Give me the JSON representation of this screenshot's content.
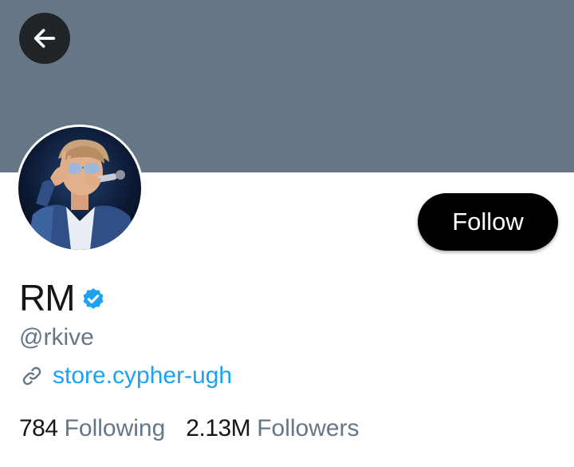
{
  "profile": {
    "name": "RM",
    "handle": "@rkive",
    "website": "store.cypher-ugh",
    "following_count": "784",
    "following_label": "Following",
    "followers_count": "2.13M",
    "followers_label": "Followers",
    "verified": true
  },
  "actions": {
    "follow_label": "Follow"
  },
  "icons": {
    "back": "arrow-left-icon",
    "verified": "verified-badge-icon",
    "link": "link-icon"
  },
  "colors": {
    "banner": "#657786",
    "accent": "#1da1f2",
    "text_primary": "#14171a",
    "text_secondary": "#657786",
    "follow_button": "#000000"
  }
}
